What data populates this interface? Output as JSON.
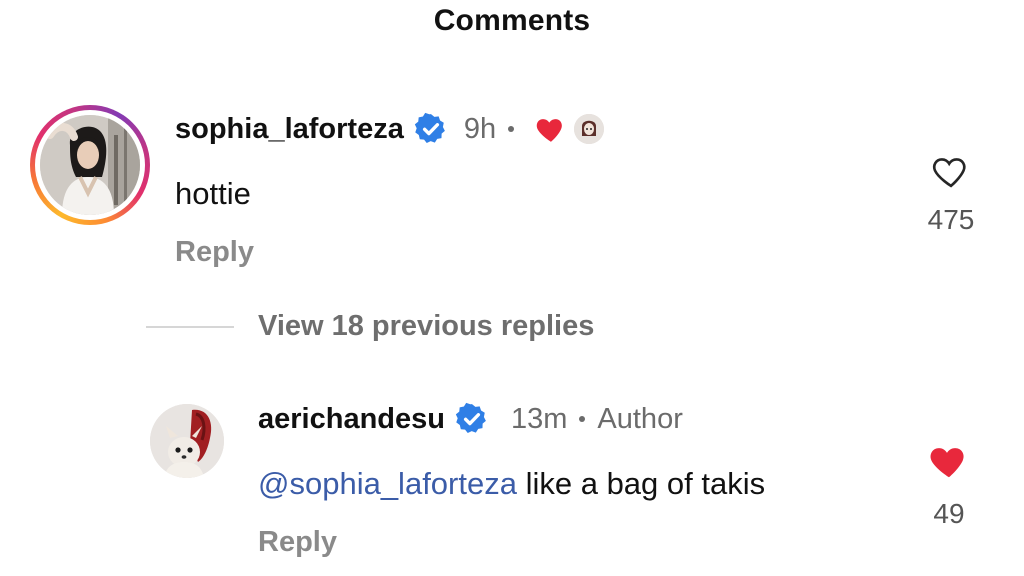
{
  "header": {
    "title": "Comments"
  },
  "comments": [
    {
      "username": "sophia_laforteza",
      "verified": true,
      "time": "9h",
      "liked_by_author": true,
      "text": "hottie",
      "reply_label": "Reply",
      "likes": "475",
      "liked": false
    }
  ],
  "view_replies": {
    "label": "View 18 previous replies"
  },
  "replies": [
    {
      "username": "aerichandesu",
      "verified": true,
      "time": "13m",
      "badge": "Author",
      "mention": "@sophia_laforteza",
      "text": " like a bag of takis",
      "reply_label": "Reply",
      "likes": "49",
      "liked": true
    }
  ],
  "colors": {
    "like_red": "#e8283c",
    "verified_blue": "#2f7fe6",
    "mention_blue": "#3b5ca8",
    "meta_gray": "#6b6b6b"
  },
  "icons": {
    "verified": "verified-badge-icon",
    "heart_outline": "heart-outline-icon",
    "heart_filled": "heart-filled-icon"
  }
}
